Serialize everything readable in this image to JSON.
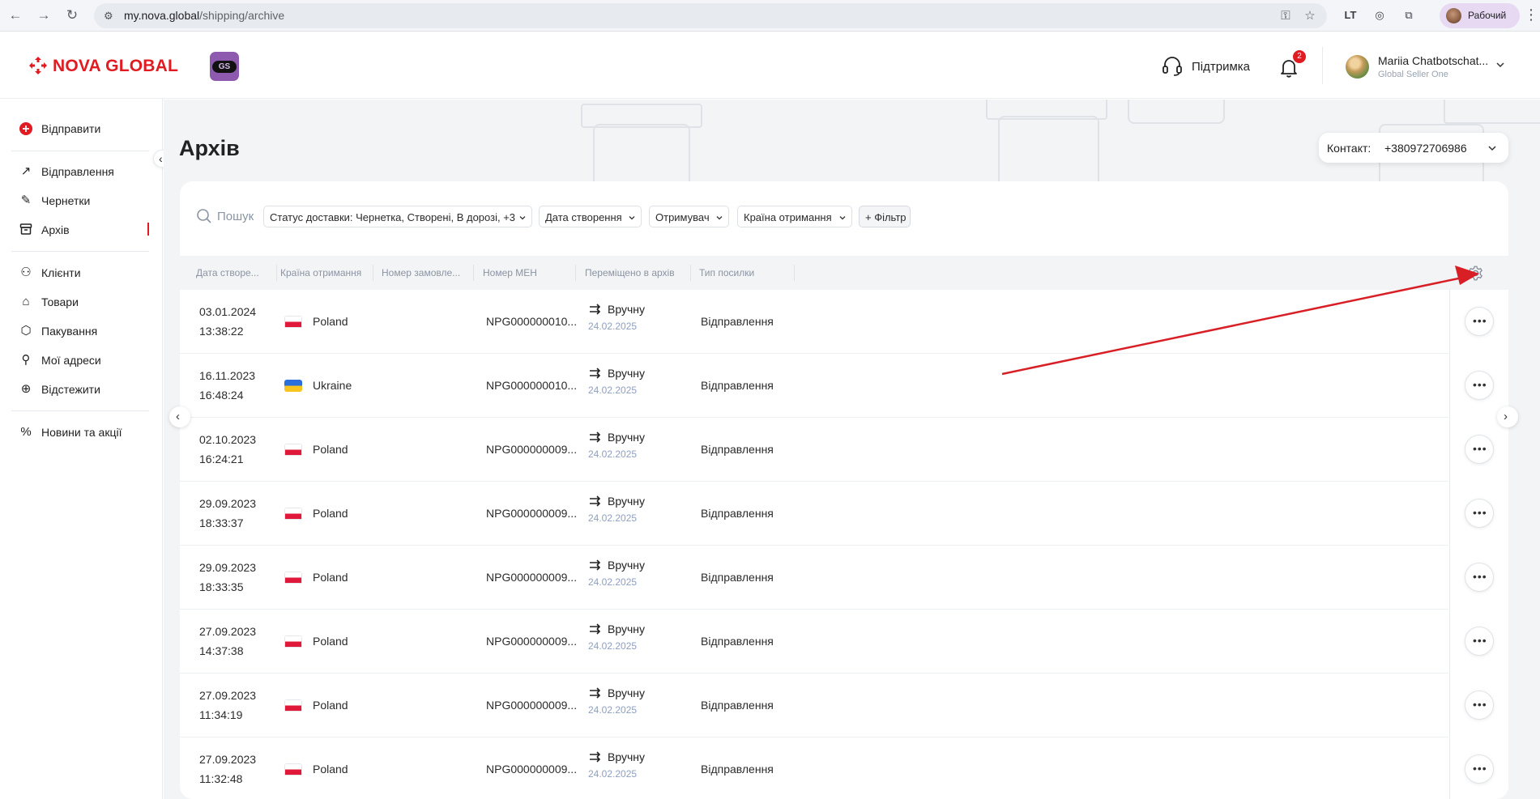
{
  "browser": {
    "url_host": "my.nova.global",
    "url_path": "/shipping/archive",
    "profile_label": "Рабочий"
  },
  "header": {
    "brand_name": "NOVA GLOBAL",
    "badge_label": "GS",
    "support_label": "Підтримка",
    "notification_count": "2",
    "user_name": "Mariia Chatbotschat...",
    "user_company": "Global Seller One"
  },
  "sidebar": {
    "send_label": "Відправити",
    "groups": [
      [
        {
          "label": "Відправлення",
          "icon": "arrow-up-right-icon",
          "active": false
        },
        {
          "label": "Чернетки",
          "icon": "edit-icon",
          "active": false
        },
        {
          "label": "Архів",
          "icon": "archive-icon",
          "active": true
        }
      ],
      [
        {
          "label": "Клієнти",
          "icon": "users-icon",
          "active": false
        },
        {
          "label": "Товари",
          "icon": "tag-icon",
          "active": false
        },
        {
          "label": "Пакування",
          "icon": "package-icon",
          "active": false
        },
        {
          "label": "Мої адреси",
          "icon": "address-icon",
          "active": false
        },
        {
          "label": "Відстежити",
          "icon": "target-icon",
          "active": false
        }
      ],
      [
        {
          "label": "Новини та акції",
          "icon": "percent-icon",
          "active": false
        }
      ]
    ]
  },
  "page": {
    "title": "Архів",
    "contact_label": "Контакт:",
    "contact_value": "+380972706986"
  },
  "filters": {
    "search_placeholder": "Пошук",
    "items": [
      "Статус доставки: Чернетка, Створені, В дорозі, +3",
      "Дата створення",
      "Отримувач",
      "Країна отримання"
    ],
    "add_filter_label": "+ Фільтр"
  },
  "table": {
    "headers": [
      "Дата створе...",
      "Країна отримання",
      "Номер замовле...",
      "Номер МЕН",
      "Переміщено в архів",
      "Тип посилки"
    ],
    "rows": [
      {
        "date": "03.01.2024",
        "time": "13:38:22",
        "country": "Poland",
        "flag": "poland",
        "men": "NPG000000010...",
        "move_label": "Вручну",
        "move_date": "24.02.2025",
        "type": "Відправлення"
      },
      {
        "date": "16.11.2023",
        "time": "16:48:24",
        "country": "Ukraine",
        "flag": "ukraine",
        "men": "NPG000000010...",
        "move_label": "Вручну",
        "move_date": "24.02.2025",
        "type": "Відправлення"
      },
      {
        "date": "02.10.2023",
        "time": "16:24:21",
        "country": "Poland",
        "flag": "poland",
        "men": "NPG000000009...",
        "move_label": "Вручну",
        "move_date": "24.02.2025",
        "type": "Відправлення"
      },
      {
        "date": "29.09.2023",
        "time": "18:33:37",
        "country": "Poland",
        "flag": "poland",
        "men": "NPG000000009...",
        "move_label": "Вручну",
        "move_date": "24.02.2025",
        "type": "Відправлення"
      },
      {
        "date": "29.09.2023",
        "time": "18:33:35",
        "country": "Poland",
        "flag": "poland",
        "men": "NPG000000009...",
        "move_label": "Вручну",
        "move_date": "24.02.2025",
        "type": "Відправлення"
      },
      {
        "date": "27.09.2023",
        "time": "14:37:38",
        "country": "Poland",
        "flag": "poland",
        "men": "NPG000000009...",
        "move_label": "Вручну",
        "move_date": "24.02.2025",
        "type": "Відправлення"
      },
      {
        "date": "27.09.2023",
        "time": "11:34:19",
        "country": "Poland",
        "flag": "poland",
        "men": "NPG000000009...",
        "move_label": "Вручну",
        "move_date": "24.02.2025",
        "type": "Відправлення"
      },
      {
        "date": "27.09.2023",
        "time": "11:32:48",
        "country": "Poland",
        "flag": "poland",
        "men": "NPG000000009...",
        "move_label": "Вручну",
        "move_date": "24.02.2025",
        "type": "Відправлення"
      }
    ]
  },
  "colors": {
    "brand": "#e11b22",
    "badge": "#8d5ab0",
    "annotation_arrow": "#d91f26",
    "date_muted": "#8e9fc0"
  }
}
